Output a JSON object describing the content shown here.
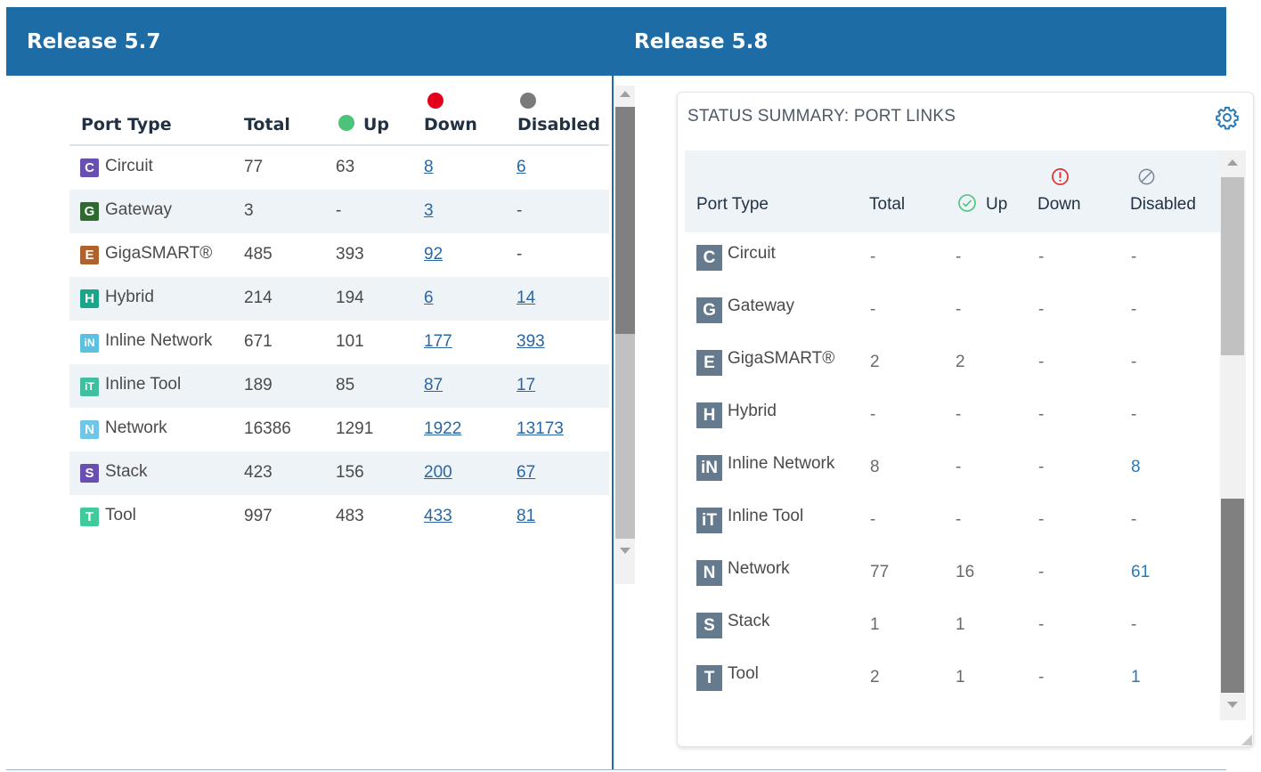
{
  "left": {
    "title": "Release 5.7",
    "headers": {
      "port_type": "Port Type",
      "total": "Total",
      "up": "Up",
      "down": "Down",
      "disabled": "Disabled"
    },
    "colors": {
      "up": "#4cc27a",
      "down": "#e3001b",
      "disabled": "#7a7a7a"
    },
    "rows": [
      {
        "badge": "C",
        "badge_color": "#6a4fb3",
        "name": "Circuit",
        "total": "77",
        "up": "63",
        "down": "8",
        "disabled": "6"
      },
      {
        "badge": "G",
        "badge_color": "#2e6b2e",
        "name": "Gateway",
        "total": "3",
        "up": "-",
        "down": "3",
        "disabled": "-"
      },
      {
        "badge": "E",
        "badge_color": "#b0622a",
        "name": "GigaSMART®",
        "total": "485",
        "up": "393",
        "down": "92",
        "disabled": "-"
      },
      {
        "badge": "H",
        "badge_color": "#1aa68a",
        "name": "Hybrid",
        "total": "214",
        "up": "194",
        "down": "6",
        "disabled": "14"
      },
      {
        "badge": "iN",
        "badge_color": "#5cc0e3",
        "name": "Inline Network",
        "total": "671",
        "up": "101",
        "down": "177",
        "disabled": "393"
      },
      {
        "badge": "iT",
        "badge_color": "#3fbf9f",
        "name": "Inline Tool",
        "total": "189",
        "up": "85",
        "down": "87",
        "disabled": "17"
      },
      {
        "badge": "N",
        "badge_color": "#6ec7e8",
        "name": "Network",
        "total": "16386",
        "up": "1291",
        "down": "1922",
        "disabled": "13173"
      },
      {
        "badge": "S",
        "badge_color": "#6a4fb3",
        "name": "Stack",
        "total": "423",
        "up": "156",
        "down": "200",
        "disabled": "67"
      },
      {
        "badge": "T",
        "badge_color": "#3fcc9a",
        "name": "Tool",
        "total": "997",
        "up": "483",
        "down": "433",
        "disabled": "81"
      }
    ]
  },
  "right": {
    "title": "Release 5.8",
    "panel_title": "STATUS SUMMARY: PORT LINKS",
    "headers": {
      "port_type": "Port Type",
      "total": "Total",
      "up": "Up",
      "down": "Down",
      "disabled": "Disabled"
    },
    "colors": {
      "up_icon": "#4cc27a",
      "down_icon": "#e03030",
      "disabled_icon": "#7a8896",
      "badge": "#657b8d",
      "link": "#2a79b7"
    },
    "rows": [
      {
        "badge": "C",
        "name": "Circuit",
        "total": "-",
        "up": "-",
        "down": "-",
        "disabled": "-"
      },
      {
        "badge": "G",
        "name": "Gateway",
        "total": "-",
        "up": "-",
        "down": "-",
        "disabled": "-"
      },
      {
        "badge": "E",
        "name": "GigaSMART®",
        "total": "2",
        "up": "2",
        "down": "-",
        "disabled": "-"
      },
      {
        "badge": "H",
        "name": "Hybrid",
        "total": "-",
        "up": "-",
        "down": "-",
        "disabled": "-"
      },
      {
        "badge": "iN",
        "name": "Inline Network",
        "total": "8",
        "up": "-",
        "down": "-",
        "disabled": "8"
      },
      {
        "badge": "iT",
        "name": "Inline Tool",
        "total": "-",
        "up": "-",
        "down": "-",
        "disabled": "-"
      },
      {
        "badge": "N",
        "name": "Network",
        "total": "77",
        "up": "16",
        "down": "-",
        "disabled": "61"
      },
      {
        "badge": "S",
        "name": "Stack",
        "total": "1",
        "up": "1",
        "down": "-",
        "disabled": "-"
      },
      {
        "badge": "T",
        "name": "Tool",
        "total": "2",
        "up": "1",
        "down": "-",
        "disabled": "1"
      }
    ]
  }
}
